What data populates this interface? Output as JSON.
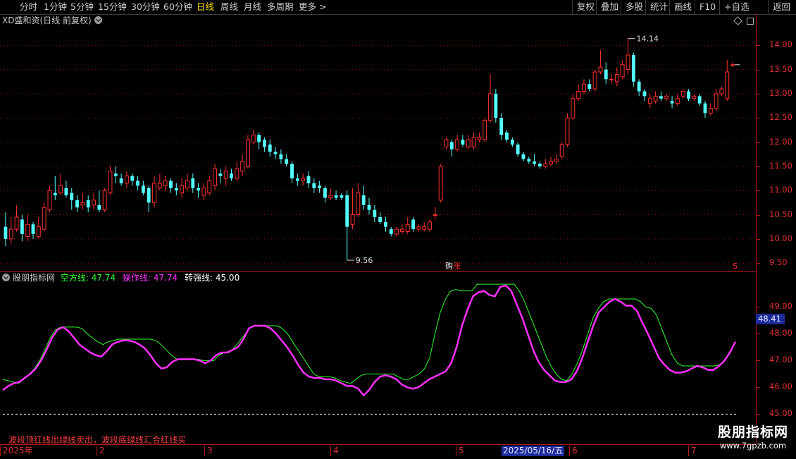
{
  "toolbar": {
    "left": [
      {
        "label": "分时",
        "active": false
      },
      {
        "label": "1分钟",
        "active": false
      },
      {
        "label": "5分钟",
        "active": false
      },
      {
        "label": "15分钟",
        "active": false
      },
      {
        "label": "30分钟",
        "active": false
      },
      {
        "label": "60分钟",
        "active": false
      },
      {
        "label": "日线",
        "active": true
      },
      {
        "label": "周线",
        "active": false
      },
      {
        "label": "月线",
        "active": false
      },
      {
        "label": "多周期",
        "active": false
      },
      {
        "label": "更多 >",
        "active": false
      }
    ],
    "right": [
      "复权",
      "叠加",
      "多股",
      "统计",
      "画线",
      "F10",
      "+自选",
      "返回"
    ]
  },
  "price_chart": {
    "title": "XD盛和资(日线 前复权)",
    "high_label": "14.14",
    "low_label": "9.56",
    "marker_buy": "购",
    "marker_zhang": "涨",
    "marker_s": "S",
    "y_ticks": [
      "14.00",
      "13.50",
      "13.00",
      "12.50",
      "12.00",
      "11.50",
      "11.00",
      "10.50",
      "10.00",
      "9.50"
    ],
    "colors": {
      "up": "#ff3030",
      "down": "#54ffff"
    }
  },
  "indicator": {
    "name": "股朋指标网",
    "kongfang_label": "空方线:",
    "kongfang_value": "47.74",
    "caozuo_label": "操作线:",
    "caozuo_value": "47.74",
    "zhuanqiang_label": "转强线:",
    "zhuanqiang_value": "45.00",
    "y_ticks": [
      "49.00",
      "48.00",
      "47.00",
      "46.00",
      "45.00"
    ],
    "current_value": "48.41",
    "note": "波段顶红线出绿线卖出，波段底绿线汇合红线买",
    "colors": {
      "kongfang": "#30ff30",
      "caozuo": "#ff30ff",
      "zhuanqiang": "#ffffff"
    }
  },
  "date_axis": {
    "labels": [
      "2025年",
      "2",
      "3",
      "4",
      "5",
      "6",
      "7"
    ],
    "highlight": "2025/05/16/五"
  },
  "watermark": {
    "title": "股朋指标网",
    "url": "www.7gpzb.com"
  },
  "chart_data": [
    {
      "type": "candlestick",
      "title": "XD盛和资(日线 前复权)",
      "ylim": [
        9.4,
        14.5
      ],
      "y_ticks": [
        14.0,
        13.5,
        13.0,
        12.5,
        12.0,
        11.5,
        11.0,
        10.5,
        10.0,
        9.5
      ],
      "annotations": [
        {
          "text": "14.14",
          "type": "high"
        },
        {
          "text": "9.56",
          "type": "low"
        }
      ],
      "x_labels": [
        "2025年",
        "2",
        "3",
        "4",
        "5",
        "6",
        "7"
      ],
      "candles": [
        [
          10.25,
          10.0,
          10.55,
          9.85
        ],
        [
          10.0,
          10.2,
          10.45,
          9.9
        ],
        [
          10.2,
          10.45,
          10.7,
          10.15
        ],
        [
          10.4,
          10.1,
          10.5,
          9.95
        ],
        [
          10.05,
          10.3,
          10.5,
          9.95
        ],
        [
          10.3,
          10.1,
          10.35,
          10.0
        ],
        [
          10.05,
          10.25,
          10.45,
          10.0
        ],
        [
          10.2,
          10.65,
          10.75,
          10.15
        ],
        [
          10.6,
          11.0,
          11.1,
          10.55
        ],
        [
          10.95,
          10.9,
          11.3,
          10.8
        ],
        [
          10.95,
          11.1,
          11.35,
          10.9
        ],
        [
          11.05,
          10.9,
          11.2,
          10.85
        ],
        [
          10.95,
          10.8,
          11.05,
          10.6
        ],
        [
          10.8,
          10.65,
          10.9,
          10.55
        ],
        [
          10.7,
          10.75,
          10.95,
          10.6
        ],
        [
          10.8,
          10.65,
          10.9,
          10.55
        ],
        [
          10.7,
          10.8,
          10.95,
          10.6
        ],
        [
          10.7,
          10.6,
          11.0,
          10.55
        ],
        [
          10.6,
          11.0,
          11.05,
          10.55
        ],
        [
          10.95,
          11.4,
          11.5,
          10.9
        ],
        [
          11.35,
          11.3,
          11.5,
          11.15
        ],
        [
          11.25,
          11.15,
          11.35,
          11.1
        ],
        [
          11.15,
          11.3,
          11.4,
          11.05
        ],
        [
          11.3,
          11.2,
          11.35,
          11.1
        ],
        [
          11.2,
          11.1,
          11.3,
          11.0
        ],
        [
          11.1,
          10.95,
          11.2,
          10.9
        ],
        [
          11.05,
          10.75,
          11.1,
          10.55
        ],
        [
          10.75,
          11.15,
          11.3,
          10.65
        ],
        [
          11.05,
          11.15,
          11.35,
          11.0
        ],
        [
          11.1,
          11.2,
          11.3,
          11.0
        ],
        [
          11.2,
          11.05,
          11.25,
          10.95
        ],
        [
          11.05,
          11.0,
          11.15,
          10.9
        ],
        [
          10.95,
          11.1,
          11.25,
          10.85
        ],
        [
          11.05,
          11.2,
          11.35,
          11.0
        ],
        [
          11.25,
          11.05,
          11.35,
          10.95
        ],
        [
          11.05,
          11.0,
          11.15,
          10.85
        ],
        [
          10.9,
          11.05,
          11.15,
          10.8
        ],
        [
          10.95,
          11.2,
          11.3,
          10.9
        ],
        [
          11.1,
          11.45,
          11.55,
          11.0
        ],
        [
          11.35,
          11.3,
          11.45,
          11.15
        ],
        [
          11.25,
          11.4,
          11.5,
          11.1
        ],
        [
          11.35,
          11.25,
          11.45,
          11.2
        ],
        [
          11.25,
          11.45,
          11.6,
          11.2
        ],
        [
          11.4,
          11.6,
          11.75,
          11.3
        ],
        [
          11.5,
          12.05,
          12.15,
          11.45
        ],
        [
          12.0,
          12.15,
          12.25,
          11.95
        ],
        [
          12.15,
          12.0,
          12.2,
          11.85
        ],
        [
          12.05,
          11.9,
          12.1,
          11.8
        ],
        [
          11.95,
          11.8,
          12.05,
          11.7
        ],
        [
          11.8,
          11.75,
          11.9,
          11.65
        ],
        [
          11.75,
          11.65,
          11.85,
          11.55
        ],
        [
          11.65,
          11.55,
          11.75,
          11.5
        ],
        [
          11.55,
          11.25,
          11.6,
          11.15
        ],
        [
          11.25,
          11.2,
          11.35,
          11.1
        ],
        [
          11.2,
          11.25,
          11.35,
          11.1
        ],
        [
          11.3,
          11.15,
          11.4,
          11.05
        ],
        [
          11.15,
          11.05,
          11.25,
          10.95
        ],
        [
          11.1,
          11.05,
          11.2,
          10.95
        ],
        [
          11.05,
          10.85,
          11.1,
          10.75
        ],
        [
          10.85,
          10.9,
          11.05,
          10.8
        ],
        [
          10.9,
          10.85,
          11.0,
          10.8
        ],
        [
          10.9,
          10.85,
          10.95,
          10.8
        ],
        [
          10.9,
          10.25,
          11.0,
          9.56
        ],
        [
          10.3,
          10.5,
          11.05,
          10.2
        ],
        [
          10.5,
          10.95,
          11.15,
          10.45
        ],
        [
          10.9,
          10.7,
          11.1,
          10.6
        ],
        [
          10.7,
          10.6,
          10.85,
          10.5
        ],
        [
          10.6,
          10.45,
          10.7,
          10.35
        ],
        [
          10.45,
          10.35,
          10.55,
          10.3
        ],
        [
          10.35,
          10.25,
          10.45,
          10.15
        ],
        [
          10.2,
          10.1,
          10.25,
          10.05
        ],
        [
          10.1,
          10.2,
          10.25,
          10.05
        ],
        [
          10.15,
          10.2,
          10.3,
          10.1
        ],
        [
          10.15,
          10.3,
          10.45,
          10.1
        ],
        [
          10.4,
          10.2,
          10.45,
          10.15
        ],
        [
          10.2,
          10.25,
          10.3,
          10.15
        ],
        [
          10.2,
          10.25,
          10.35,
          10.15
        ],
        [
          10.2,
          10.35,
          10.4,
          10.15
        ],
        [
          10.5,
          10.5,
          10.65,
          10.4
        ],
        [
          10.8,
          11.5,
          11.55,
          10.75
        ],
        [
          11.9,
          12.05,
          12.1,
          11.85
        ],
        [
          12.0,
          11.85,
          12.05,
          11.7
        ],
        [
          11.85,
          12.05,
          12.15,
          11.8
        ],
        [
          12.05,
          11.95,
          12.15,
          11.9
        ],
        [
          11.9,
          12.05,
          12.15,
          11.85
        ],
        [
          11.9,
          12.1,
          12.2,
          11.85
        ],
        [
          12.05,
          12.1,
          12.2,
          12.0
        ],
        [
          12.05,
          12.45,
          12.5,
          12.0
        ],
        [
          12.45,
          13.0,
          13.4,
          12.4
        ],
        [
          13.0,
          12.5,
          13.1,
          12.4
        ],
        [
          12.5,
          12.15,
          12.6,
          12.05
        ],
        [
          12.2,
          12.05,
          12.25,
          12.0
        ],
        [
          12.05,
          11.95,
          12.1,
          11.9
        ],
        [
          11.95,
          11.75,
          12.0,
          11.7
        ],
        [
          11.75,
          11.65,
          11.8,
          11.6
        ],
        [
          11.65,
          11.6,
          11.7,
          11.55
        ],
        [
          11.6,
          11.55,
          11.75,
          11.5
        ],
        [
          11.55,
          11.5,
          11.6,
          11.45
        ],
        [
          11.5,
          11.55,
          11.65,
          11.45
        ],
        [
          11.55,
          11.6,
          11.7,
          11.5
        ],
        [
          11.6,
          11.65,
          11.75,
          11.55
        ],
        [
          11.7,
          11.95,
          12.0,
          11.65
        ],
        [
          11.95,
          12.5,
          12.6,
          11.9
        ],
        [
          12.5,
          12.9,
          13.0,
          12.45
        ],
        [
          12.9,
          13.05,
          13.2,
          12.85
        ],
        [
          13.05,
          13.2,
          13.3,
          13.0
        ],
        [
          13.2,
          13.1,
          13.3,
          13.05
        ],
        [
          13.1,
          13.45,
          13.5,
          13.05
        ],
        [
          13.45,
          13.55,
          13.9,
          13.4
        ],
        [
          13.5,
          13.3,
          13.65,
          13.2
        ],
        [
          13.3,
          13.3,
          13.4,
          13.2
        ],
        [
          13.25,
          13.4,
          13.55,
          13.15
        ],
        [
          13.35,
          13.6,
          13.7,
          13.3
        ],
        [
          13.5,
          13.8,
          14.14,
          13.4
        ],
        [
          13.8,
          13.25,
          13.85,
          13.15
        ],
        [
          13.25,
          13.05,
          13.3,
          12.95
        ],
        [
          13.05,
          12.95,
          13.1,
          12.85
        ],
        [
          12.8,
          12.9,
          13.0,
          12.7
        ],
        [
          12.85,
          12.95,
          13.05,
          12.8
        ],
        [
          12.95,
          12.9,
          13.05,
          12.85
        ],
        [
          12.9,
          12.95,
          13.0,
          12.85
        ],
        [
          12.85,
          12.8,
          12.95,
          12.7
        ],
        [
          12.8,
          12.9,
          13.0,
          12.75
        ],
        [
          12.95,
          13.05,
          13.1,
          12.9
        ],
        [
          13.05,
          12.9,
          13.1,
          12.85
        ],
        [
          12.9,
          12.95,
          13.0,
          12.85
        ],
        [
          12.95,
          12.8,
          13.0,
          12.75
        ],
        [
          12.8,
          12.6,
          12.85,
          12.5
        ],
        [
          12.6,
          12.7,
          12.8,
          12.55
        ],
        [
          12.7,
          13.0,
          13.1,
          12.65
        ],
        [
          13.0,
          13.1,
          13.15,
          12.95
        ],
        [
          12.9,
          13.45,
          13.7,
          12.85
        ],
        [
          13.6,
          13.6,
          13.65,
          13.55
        ]
      ]
    },
    {
      "type": "line",
      "title": "股朋指标网",
      "ylim": [
        44.8,
        49.8
      ],
      "y_ticks": [
        49.0,
        48.0,
        47.0,
        46.0,
        45.0
      ],
      "series": [
        {
          "name": "空方线",
          "color": "#30ff30",
          "values": [
            46.3,
            46.25,
            46.2,
            46.15,
            46.3,
            46.5,
            46.7,
            47.0,
            47.4,
            47.85,
            48.15,
            48.25,
            48.25,
            48.25,
            48.25,
            48.2,
            48.0,
            47.85,
            47.7,
            47.6,
            47.7,
            47.75,
            47.8,
            47.8,
            47.8,
            47.8,
            47.8,
            47.8,
            47.8,
            47.75,
            47.6,
            47.4,
            47.2,
            47.05,
            47.05,
            47.05,
            47.05,
            47.05,
            47.0,
            47.0,
            47.0,
            47.2,
            47.3,
            47.3,
            47.5,
            47.75,
            48.0,
            48.25,
            48.3,
            48.3,
            48.3,
            48.3,
            48.3,
            48.2,
            48.0,
            47.7,
            47.4,
            47.1,
            46.8,
            46.5,
            46.4,
            46.4,
            46.4,
            46.35,
            46.25,
            46.2,
            46.15,
            46.3,
            46.45,
            46.5,
            46.5,
            46.5,
            46.5,
            46.5,
            46.5,
            46.4,
            46.3,
            46.3,
            46.4,
            46.5,
            46.7,
            47.1,
            48.0,
            48.8,
            49.3,
            49.6,
            49.65,
            49.6,
            49.6,
            49.6,
            49.85,
            49.85,
            49.85,
            49.85,
            49.85,
            49.85,
            49.85,
            49.85,
            49.6,
            49.2,
            48.7,
            48.2,
            47.7,
            47.2,
            46.8,
            46.5,
            46.3,
            46.25,
            46.5,
            46.9,
            47.4,
            48.0,
            48.6,
            48.95,
            49.2,
            49.3,
            49.3,
            49.3,
            49.3,
            49.3,
            49.3,
            49.2,
            49.0,
            48.95,
            48.7,
            48.2,
            47.7,
            47.2,
            46.9,
            46.8,
            46.8,
            46.8,
            46.8,
            46.8,
            46.8,
            46.8,
            46.85,
            47.0,
            47.3,
            47.7
          ]
        },
        {
          "name": "操作线",
          "color": "#ff30ff",
          "values": [
            45.9,
            46.05,
            46.15,
            46.2,
            46.35,
            46.5,
            46.7,
            47.0,
            47.4,
            47.85,
            48.15,
            48.25,
            48.1,
            47.85,
            47.6,
            47.45,
            47.3,
            47.2,
            47.15,
            47.35,
            47.6,
            47.7,
            47.75,
            47.75,
            47.7,
            47.6,
            47.45,
            47.2,
            46.9,
            46.7,
            46.75,
            46.95,
            47.05,
            47.05,
            47.05,
            47.05,
            47.0,
            46.9,
            47.0,
            47.2,
            47.3,
            47.3,
            47.4,
            47.5,
            47.8,
            48.2,
            48.3,
            48.3,
            48.3,
            48.2,
            48.0,
            47.75,
            47.5,
            47.2,
            46.85,
            46.55,
            46.4,
            46.35,
            46.35,
            46.3,
            46.3,
            46.25,
            46.15,
            46.05,
            46.05,
            45.95,
            45.7,
            45.9,
            46.2,
            46.4,
            46.45,
            46.4,
            46.3,
            46.1,
            46.0,
            45.95,
            46.0,
            46.15,
            46.3,
            46.4,
            46.5,
            46.6,
            46.9,
            47.5,
            48.3,
            48.9,
            49.4,
            49.55,
            49.6,
            49.45,
            49.4,
            49.75,
            49.8,
            49.6,
            49.1,
            48.6,
            48.0,
            47.4,
            46.95,
            46.65,
            46.45,
            46.25,
            46.2,
            46.2,
            46.3,
            46.6,
            47.1,
            47.7,
            48.3,
            48.8,
            49.0,
            49.2,
            49.3,
            49.2,
            49.05,
            49.05,
            48.85,
            48.4,
            48.0,
            47.55,
            47.1,
            46.85,
            46.65,
            46.55,
            46.55,
            46.6,
            46.7,
            46.8,
            46.75,
            46.65,
            46.65,
            46.8,
            47.0,
            47.3,
            47.7
          ]
        },
        {
          "name": "转强线",
          "color": "#ffffff",
          "values": [
            45.0,
            45.0
          ]
        }
      ]
    }
  ]
}
